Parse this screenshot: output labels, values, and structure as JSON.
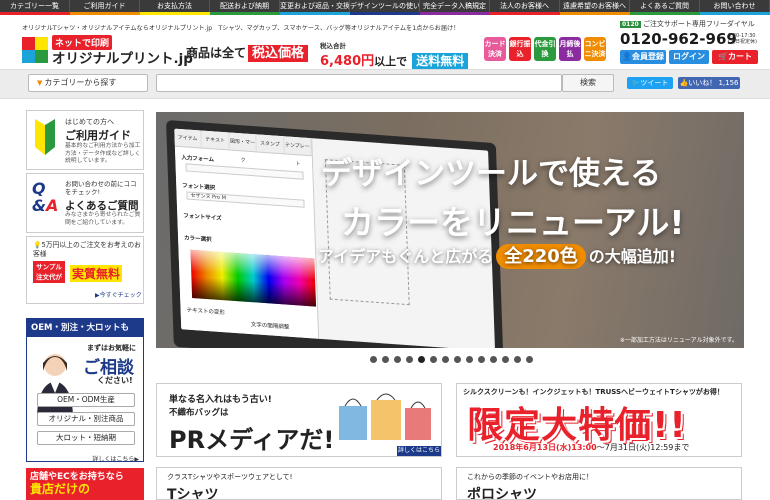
{
  "topnav": {
    "items": [
      "カテゴリー一覧",
      "ご利用ガイド",
      "お支払方法",
      "配送および納期",
      "変更および返品・交換",
      "デザインツールの使い方",
      "完全データ入稿規定",
      "法人のお客様へ",
      "遠慮希望のお客様へ",
      "よくあるご質問",
      "お問い合わせ"
    ],
    "strip_colors": [
      "#e8212a",
      "#f08c00",
      "#ffe600",
      "#2b9a3e",
      "#1aa4d9",
      "#1d3a8a",
      "#8a2ba0",
      "#e8212a",
      "#f08c00",
      "#2b9a3e",
      "#1aa4d9"
    ]
  },
  "header": {
    "tagline": "オリジナルTシャツ・オリジナルアイテムならオリジナルプリント.jp　Tシャツ、マグカップ、スマホケース、バッグ等オリジナルアイテムを1点からお届け！",
    "logo_sub": "ネットで印刷",
    "logo_main": "オリジナルプリント.jp",
    "promo_all": "商品は全て",
    "promo_tax": "税込価格",
    "promo_total": "税込合計",
    "promo_price": "6,480円",
    "promo_above": "以上で",
    "promo_free": "送料無料",
    "payments": [
      {
        "label": "カード決済",
        "color": "#e85a9a"
      },
      {
        "label": "銀行振込",
        "color": "#e8212a"
      },
      {
        "label": "代金引換",
        "color": "#2b9a3e"
      },
      {
        "label": "月締後払",
        "color": "#8a2ba0"
      },
      {
        "label": "コンビニ決済",
        "color": "#f08c00"
      }
    ],
    "phone_badge": "0120",
    "phone_label": "ご注文サポート専用フリーダイヤル",
    "phone_number": "0120-962-969",
    "phone_hours_1": "9:30-17:30",
    "phone_hours_2": "(土日祝定休)",
    "member_label": "会員登録",
    "login_label": "ログイン",
    "cart_label": "カート"
  },
  "search": {
    "category_label": "カテゴリーから探す",
    "placeholder": "",
    "button_label": "検索",
    "tweet_label": "ツイート",
    "like_label": "いいね！ 1,156"
  },
  "sidebar": {
    "guide_t1": "はじめての方へ",
    "guide_t2": "ご利用ガイド",
    "guide_t3": "基本的なご利用方法から加工方法・データ作成など詳しく説明しています。",
    "faq_t1": "お問い合わせの前にココをチェック!",
    "faq_t2": "よくあるご質問",
    "faq_t3": "みなさまから寄せられたご質問をご紹介しています。",
    "quote_t1": "5万円以上のご注文をお考えのお客様",
    "quote_sample": "サンプル注文代が",
    "quote_free": "実質無料",
    "quote_check": "今すぐチェック",
    "oem_header": "OEM・別注・大ロットも",
    "oem_t1": "まずはお気軽に",
    "oem_t2": "ご相談",
    "oem_t3": "ください!",
    "oem_items": [
      "OEM・ODM生産",
      "オリジナル・別注商品",
      "大ロット・短納期"
    ],
    "oem_more": "詳しくはこちら",
    "store_t1": "店舗やECをお持ちなら",
    "store_t2": "貴店だけの"
  },
  "hero": {
    "line1": "デザインツールで使える",
    "line2": "カラーをリニューアル!",
    "line3a": "アイデアもぐんと広がる",
    "line3b": "全220色",
    "line3c": "の大幅追加!",
    "note": "※一部加工方法はリニューアル対象外です。",
    "tool_tabs": [
      "アイテム",
      "テキスト",
      "図形・マーク",
      "スタンプ",
      "テンプレート"
    ],
    "tool_input": "入力フォーム",
    "tool_font": "フォント選択",
    "tool_font_value": "セザンヌ Pro M",
    "tool_size": "フォントサイズ",
    "tool_color": "カラー選択",
    "tool_text_change": "テキストの変形",
    "tool_text_spacing": "文字の間隔調整"
  },
  "carousel": {
    "count": 14,
    "active": 4
  },
  "banners": {
    "b1_t1": "単なる名入れはもう古い!",
    "b1_t2": "不織布バッグは",
    "b1_t3": "PRメディアだ!",
    "b1_more": "詳しくはこちら",
    "b2_t1": "シルクスクリーンも！インクジェットも！TRUSSヘビーウェイトTシャツがお得！",
    "b2_t2": "限定大特価!!",
    "b2_date1": "2018年6月13日(水)13:00",
    "b2_date2": "〜7月31日(火)12:59まで",
    "b3_t1": "クラスTシャツやスポーツウェアとして!",
    "b3_t2": "Tシャツ",
    "b4_t1": "これからの季節のイベントやお店用に！",
    "b4_t2": "ポロシャツ"
  }
}
